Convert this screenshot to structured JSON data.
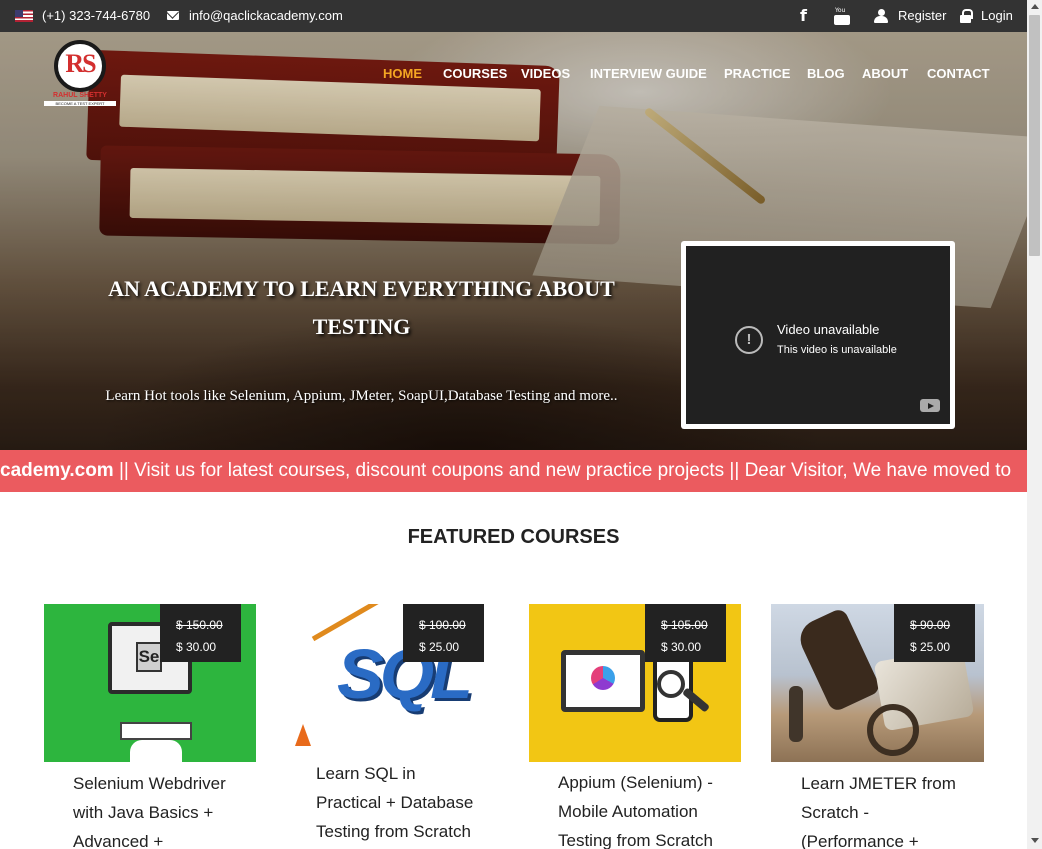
{
  "topbar": {
    "phone": "(+1) 323-744-6780",
    "email": "info@qaclickacademy.com",
    "facebook_icon": "f",
    "youtube_icon_text": "You",
    "register": "Register",
    "login": "Login",
    "icons": [
      "us-flag-icon",
      "envelope-icon",
      "facebook-icon",
      "youtube-icon",
      "user-icon",
      "lock-icon"
    ]
  },
  "logo": {
    "monogram": "RS",
    "brand": "RAHUL SHETTY",
    "tagline": "BECOME A TEST EXPERT"
  },
  "nav": {
    "items": [
      "HOME",
      "COURSES",
      "VIDEOS",
      "INTERVIEW GUIDE",
      "PRACTICE",
      "BLOG",
      "ABOUT",
      "CONTACT"
    ],
    "active": "HOME",
    "active_color": "#f5a623"
  },
  "hero": {
    "title_line1": "AN ACADEMY TO LEARN EVERYTHING ABOUT",
    "title_line2": "TESTING",
    "subtitle": "Learn Hot tools like Selenium, Appium, JMeter, SoapUI,Database Testing and more.."
  },
  "video": {
    "title": "Video unavailable",
    "subtitle": "This video is unavailable",
    "icon": "youtube-logo-icon",
    "error_icon": "!"
  },
  "marquee": {
    "lead": "cademy.com",
    "text": " || Visit us for latest courses, discount coupons and new practice projects || Dear Visitor, We have moved to",
    "background": "#eb5b5f"
  },
  "featured": {
    "title": "FEATURED COURSES",
    "courses": [
      {
        "old_price": "$ 150.00",
        "new_price": "$ 30.00",
        "title_lines": [
          "Selenium Webdriver",
          "with Java Basics +",
          "Advanced +"
        ]
      },
      {
        "old_price": "$ 100.00",
        "new_price": "$ 25.00",
        "title_lines": [
          "Learn SQL in",
          "Practical + Database",
          "Testing from Scratch"
        ]
      },
      {
        "old_price": "$ 105.00",
        "new_price": "$ 30.00",
        "title_lines": [
          "Appium (Selenium) -",
          "Mobile Automation",
          "Testing from Scratch"
        ]
      },
      {
        "old_price": "$ 90.00",
        "new_price": "$ 25.00",
        "title_lines": [
          "Learn JMETER from",
          "Scratch -",
          "(Performance +"
        ]
      }
    ],
    "card_images": {
      "sql_text": "SQL",
      "selenium_text": "Se"
    }
  }
}
